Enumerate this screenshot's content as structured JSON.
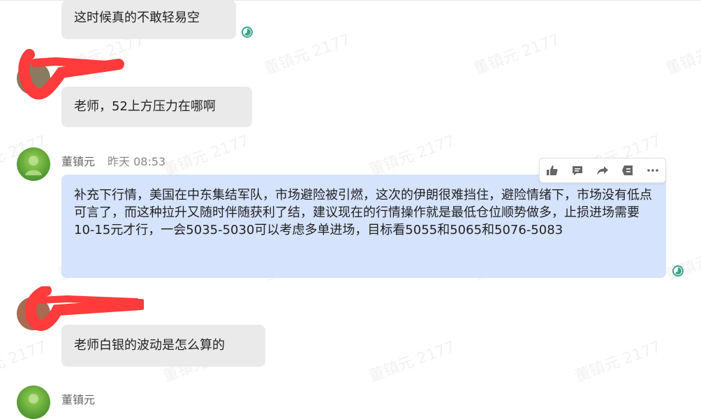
{
  "watermark_text": "董镇元 2177",
  "messages": [
    {
      "text": "这时候真的不敢轻易空"
    },
    {
      "text": "老师，52上方压力在哪啊"
    },
    {
      "sender": "董镇元",
      "time": "昨天 08:53",
      "text": "补充下行情，美国在中东集结军队，市场避险被引燃，这次的伊朗很难挡住，避险情绪下，市场没有低点可言了，而这种拉升又随时伴随获利了结，建议现在的行情操作就是最低仓位顺势做多，止损进场需要10-15元才行，一会5035-5030可以考虑多单进场，目标看5055和5065和5076-5083"
    },
    {
      "text": "老师白银的波动是怎么算的"
    },
    {
      "sender": "董镇元"
    }
  ],
  "toolbar": {
    "icons": [
      "thumbs-up-icon",
      "comment-icon",
      "forward-icon",
      "collect-icon",
      "more-icon"
    ]
  },
  "colors": {
    "incoming_bubble": "#eaeaeb",
    "own_bubble": "#d5e3fd",
    "read_status": "#3aa58a",
    "redaction": "#ff3b3b"
  }
}
